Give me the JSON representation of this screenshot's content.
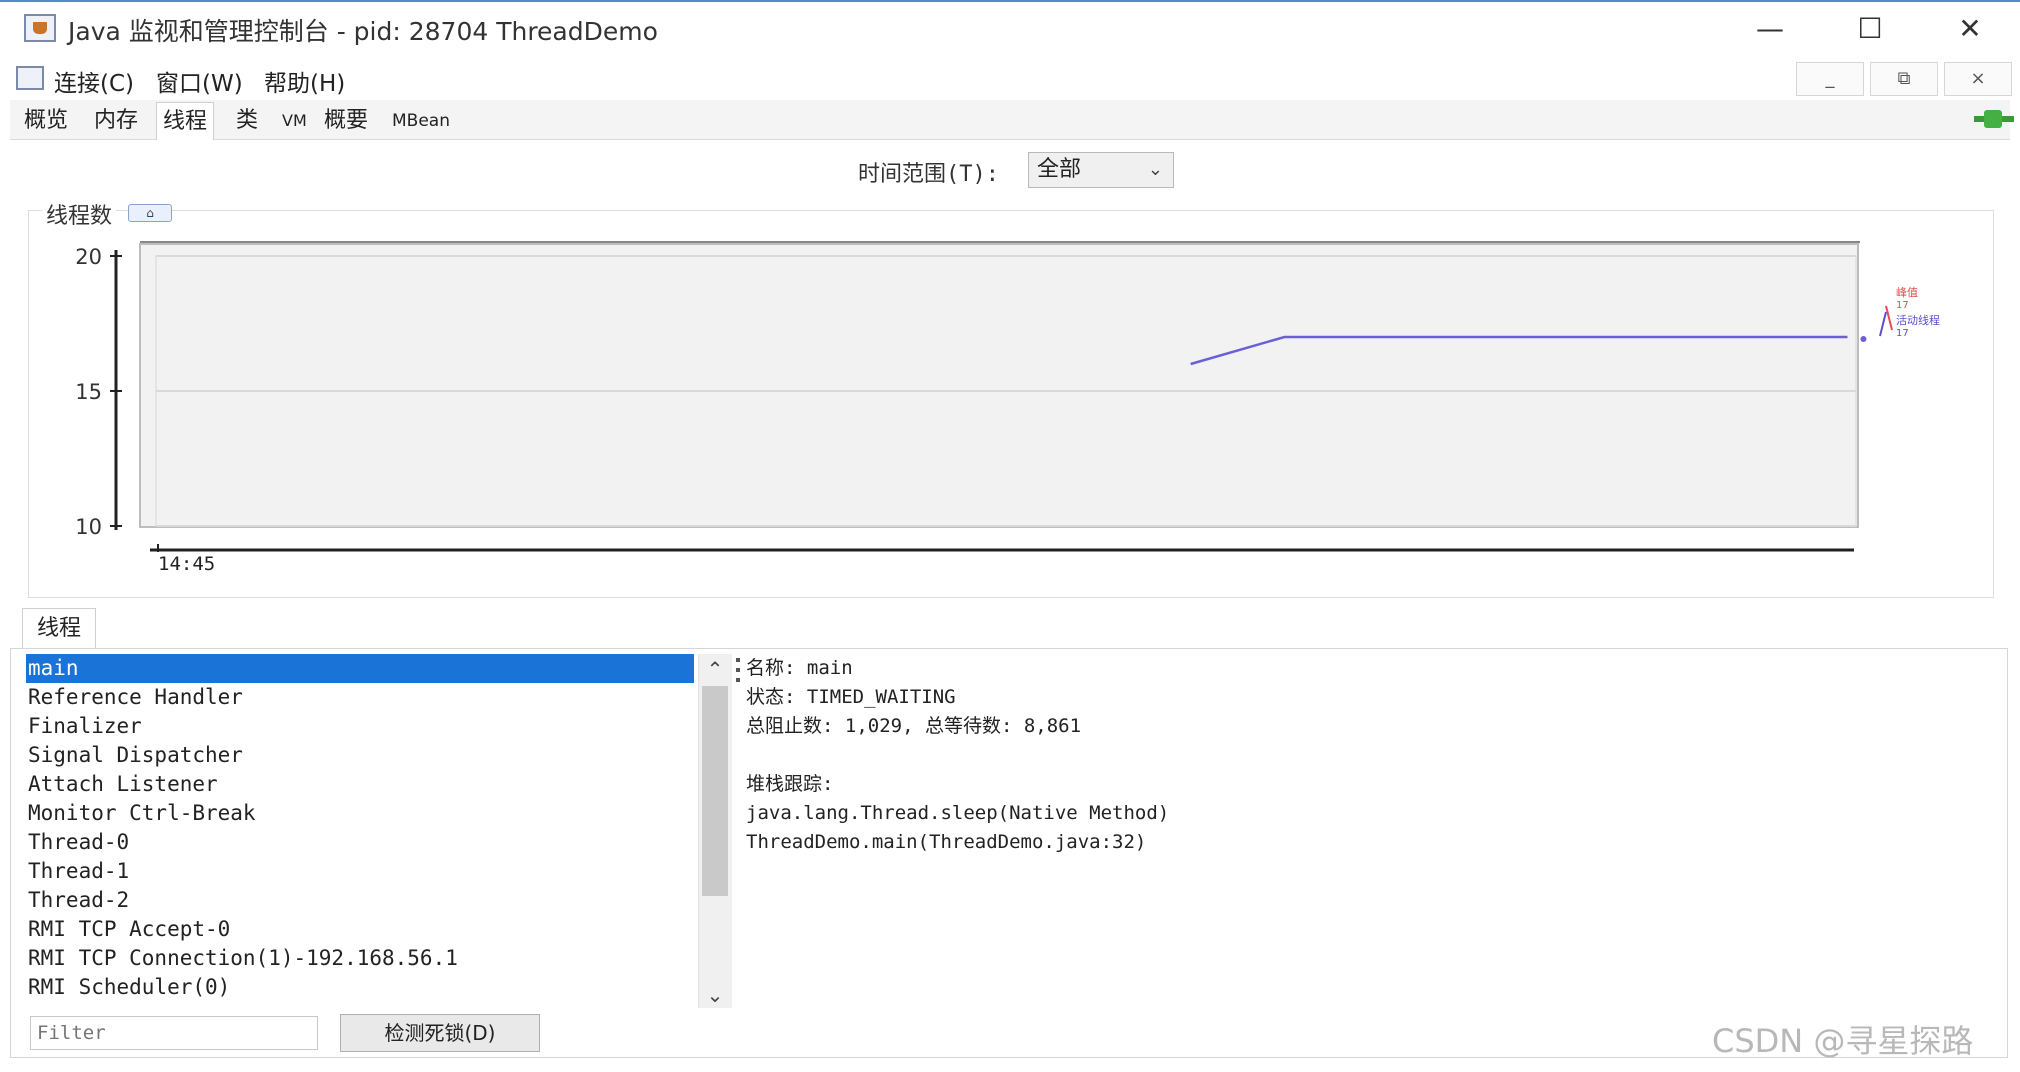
{
  "window": {
    "title": "Java 监视和管理控制台 - pid: 28704 ThreadDemo",
    "controls": {
      "minimize": "—",
      "maximize": "☐",
      "close": "✕"
    }
  },
  "menu": {
    "items": [
      "连接(C)",
      "窗口(W)",
      "帮助(H)"
    ],
    "mdi": {
      "minimize": "_",
      "restore": "⧉",
      "close": "×"
    }
  },
  "tabs": [
    "概览",
    "内存",
    "线程",
    "类",
    "VM",
    "概要",
    "MBean"
  ],
  "active_tab": "线程",
  "time_range": {
    "label": "时间范围(T):",
    "value": "全部"
  },
  "chart": {
    "title": "线程数",
    "badge": "⌂"
  },
  "chart_data": {
    "type": "line",
    "title": "线程数",
    "xlabel": "",
    "ylabel": "",
    "y_ticks": [
      "20",
      "15",
      "10"
    ],
    "x_ticks": [
      "14:45"
    ],
    "ylim": [
      10,
      20
    ],
    "grid": true,
    "legend": [
      {
        "name": "峰值",
        "value": "17",
        "color": "#e05050"
      },
      {
        "name": "活动线程",
        "value": "17",
        "color": "#5a4fd0"
      }
    ],
    "series": [
      {
        "name": "活动线程",
        "color": "#6a5fd8",
        "x": [
          0.61,
          0.665,
          0.995
        ],
        "values": [
          16,
          17,
          17
        ]
      }
    ]
  },
  "lower": {
    "tab": "线程",
    "threads": [
      "main",
      "Reference Handler",
      "Finalizer",
      "Signal Dispatcher",
      "Attach Listener",
      "Monitor Ctrl-Break",
      "Thread-0",
      "Thread-1",
      "Thread-2",
      "RMI TCP Accept-0",
      "RMI TCP Connection(1)-192.168.56.1",
      "RMI Scheduler(0)"
    ],
    "selected": "main",
    "detail": [
      "名称: main",
      "状态: TIMED_WAITING",
      "总阻止数: 1,029, 总等待数: 8,861",
      "",
      "堆栈跟踪:",
      "java.lang.Thread.sleep(Native Method)",
      "ThreadDemo.main(ThreadDemo.java:32)"
    ],
    "filter_placeholder": "Filter",
    "deadlock_button": "检测死锁(D)"
  },
  "watermark": "CSDN @寻星探路"
}
